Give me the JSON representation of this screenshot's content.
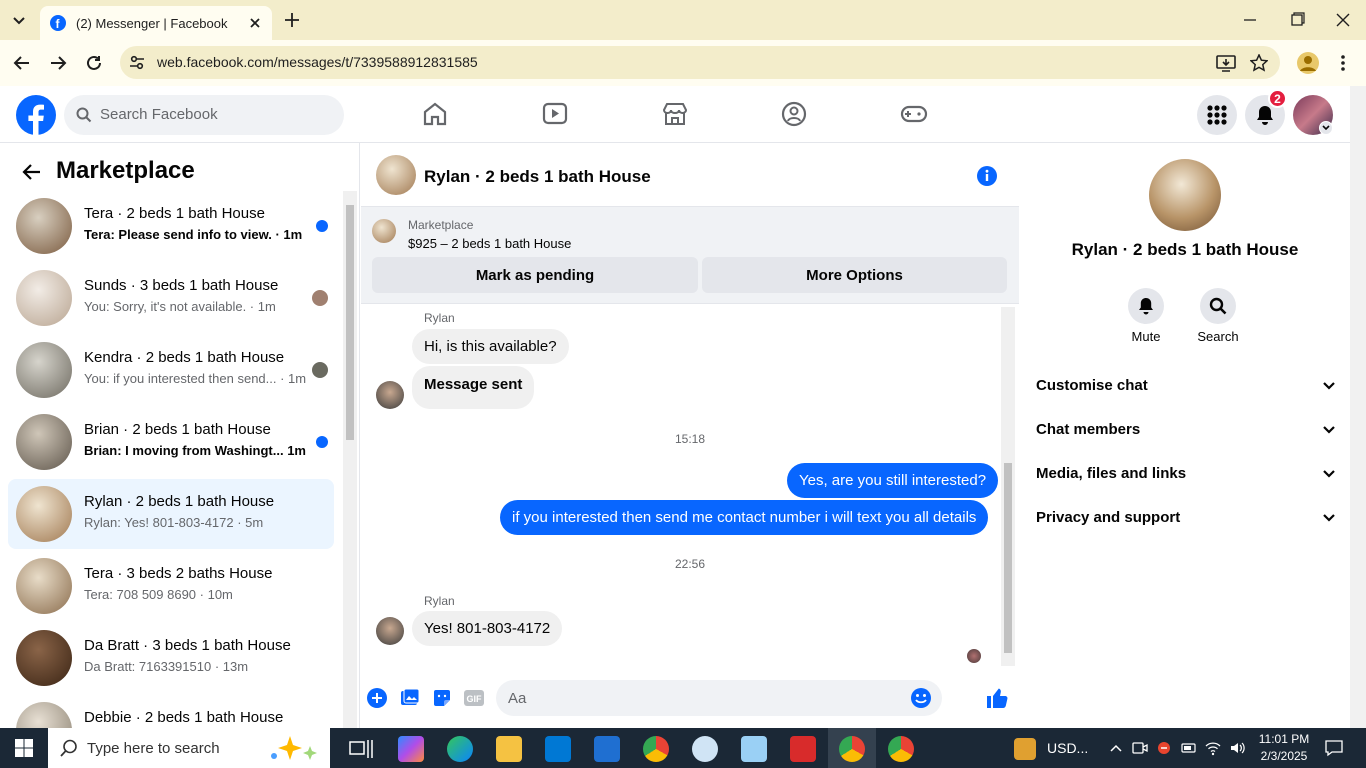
{
  "browser": {
    "tab_title": "(2) Messenger | Facebook",
    "url": "web.facebook.com/messages/t/7339588912831585"
  },
  "header": {
    "search_placeholder": "Search Facebook",
    "notification_count": "2"
  },
  "sidebar": {
    "title": "Marketplace",
    "items": [
      {
        "name": "Tera · 2 beds 1 bath House",
        "preview": "Tera: Please send info to view. · 1m",
        "unread": true,
        "color": "#8a6a4e"
      },
      {
        "name": "Sunds · 3 beds 1 bath House",
        "preview": "You: Sorry, it's not available. · 1m",
        "unread": false,
        "color": "#c9b8a8"
      },
      {
        "name": "Kendra · 2 beds 1 bath House",
        "preview": "You: if you interested then send... · 1m",
        "unread": false,
        "color": "#9a9a92"
      },
      {
        "name": "Brian · 2 beds 1 bath House",
        "preview": "Brian: I moving from Washingt...   1m",
        "unread": true,
        "color": "#7d7468"
      },
      {
        "name": "Rylan · 2 beds 1 bath House",
        "preview": "Rylan: Yes! 801-803-4172 · 5m",
        "unread": false,
        "color": "#b89468"
      },
      {
        "name": "Tera · 3 beds 2 baths House",
        "preview": "Tera: 708 509 8690 · 10m",
        "unread": false,
        "color": "#a88c6c"
      },
      {
        "name": "Da Bratt · 3 beds 1 bath House",
        "preview": "Da Bratt: 7163391510 · 13m",
        "unread": false,
        "color": "#5a3c28"
      },
      {
        "name": "Debbie · 2 beds 1 bath House",
        "preview": "",
        "unread": false,
        "color": "#b0a898"
      }
    ]
  },
  "chat": {
    "title": "Rylan · 2 beds 1 bath House",
    "listing_source": "Marketplace",
    "listing_price": "$925 – 2 beds 1 bath House",
    "mark_pending": "Mark as pending",
    "more_options": "More Options",
    "sender_name": "Rylan",
    "msg1": "Hi, is this available?",
    "msg2": "Message sent",
    "time1": "15:18",
    "msg3": "Yes, are you still interested?",
    "msg4": "if you interested then send me contact number i will text you all details",
    "time2": "22:56",
    "msg5": "Yes! 801-803-4172",
    "composer_placeholder": "Aa"
  },
  "details": {
    "title": "Rylan · 2 beds 1 bath House",
    "mute": "Mute",
    "search": "Search",
    "sections": [
      "Customise chat",
      "Chat members",
      "Media, files and links",
      "Privacy and support"
    ]
  },
  "taskbar": {
    "search_placeholder": "Type here to search",
    "currency": "USD...",
    "time": "11:01 PM",
    "date": "2/3/2025"
  },
  "colors": {
    "brand": "#0866ff",
    "unread_badge": "#e41e3f"
  }
}
